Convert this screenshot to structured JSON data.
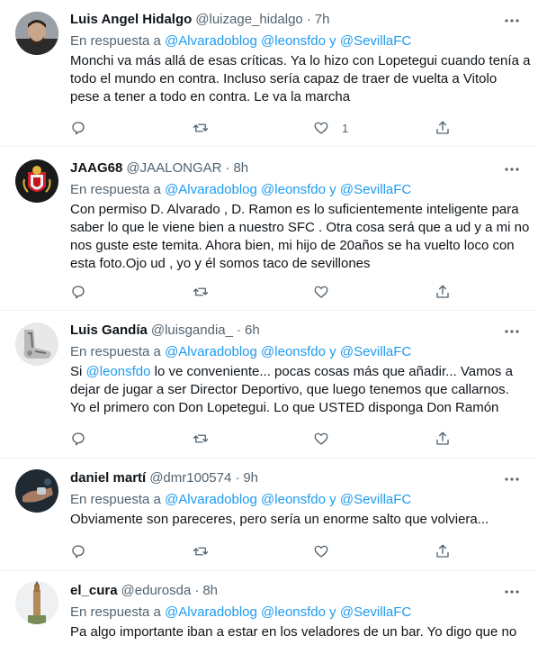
{
  "tweets": [
    {
      "name": "Luis Angel Hidalgo",
      "handle": "@luizage_hidalgo",
      "time": "7h",
      "reply_prefix": "En respuesta a",
      "mentions": [
        "@Alvaradoblog",
        "@leonsfdo",
        "@SevillaFC"
      ],
      "and_word": "y",
      "lines": [
        "Monchi va más allá de esas críticas. Ya lo hizo con Lopetegui cuando tenía a",
        "todo el mundo en contra. Incluso sería capaz de traer de vuelta a Vitolo",
        "pese a tener a todo en contra. Le va la marcha"
      ],
      "like_count": "1",
      "avatar": "man-portrait"
    },
    {
      "name": "JAAG68",
      "handle": "@JAALONGAR",
      "time": "8h",
      "reply_prefix": "En respuesta a",
      "mentions": [
        "@Alvaradoblog",
        "@leonsfdo",
        "@SevillaFC"
      ],
      "and_word": "y",
      "lines": [
        "Con permiso D. Alvarado , D. Ramon es lo suficientemente inteligente para",
        "saber lo que le viene bien a nuestro SFC . Otra cosa será que a ud y a mi no",
        "nos guste este temita. Ahora bien, mi hijo de 20años se ha vuelto loco con",
        "esta foto.Ojo ud , yo y él somos taco de sevillones"
      ],
      "like_count": "",
      "avatar": "sevilla-crest"
    },
    {
      "name": "Luis Gandía",
      "handle": "@luisgandia_",
      "time": "6h",
      "reply_prefix": "En respuesta a",
      "mentions": [
        "@Alvaradoblog",
        "@leonsfdo",
        "@SevillaFC"
      ],
      "and_word": "y",
      "line1_prefix": "Si ",
      "line1_mention": "@leonsfdo",
      "line1_suffix": " lo ve conveniente... pocas cosas más que añadir... Vamos a",
      "lines": [
        "dejar de jugar a ser Director Deportivo, que luego tenemos que callarnos.",
        "Yo el primero con Don Lopetegui. Lo que USTED disponga Don Ramón"
      ],
      "like_count": "",
      "avatar": "foot-xray"
    },
    {
      "name": "daniel martí",
      "handle": "@dmr100574",
      "time": "9h",
      "reply_prefix": "En respuesta a",
      "mentions": [
        "@Alvaradoblog",
        "@leonsfdo",
        "@SevillaFC"
      ],
      "and_word": "y",
      "lines": [
        "Obviamente son pareceres, pero sería un enorme salto que volviera..."
      ],
      "like_count": "",
      "avatar": "dark-hand"
    },
    {
      "name": "el_cura",
      "handle": "@edurosda",
      "time": "8h",
      "reply_prefix": "En respuesta a",
      "mentions": [
        "@Alvaradoblog",
        "@leonsfdo",
        "@SevillaFC"
      ],
      "and_word": "y",
      "lines": [
        "Pa algo importante iban a estar en los veladores de un bar. Yo digo que no"
      ],
      "like_count": "",
      "avatar": "giralda-tower"
    }
  ],
  "separator": "·",
  "icons": {
    "more": "more-dots-icon",
    "reply": "reply-icon",
    "retweet": "retweet-icon",
    "like": "like-icon",
    "share": "share-icon"
  },
  "colors": {
    "link": "#1d9bf0",
    "secondary": "#536471",
    "text": "#0f1419",
    "divider": "#eff3f4"
  }
}
